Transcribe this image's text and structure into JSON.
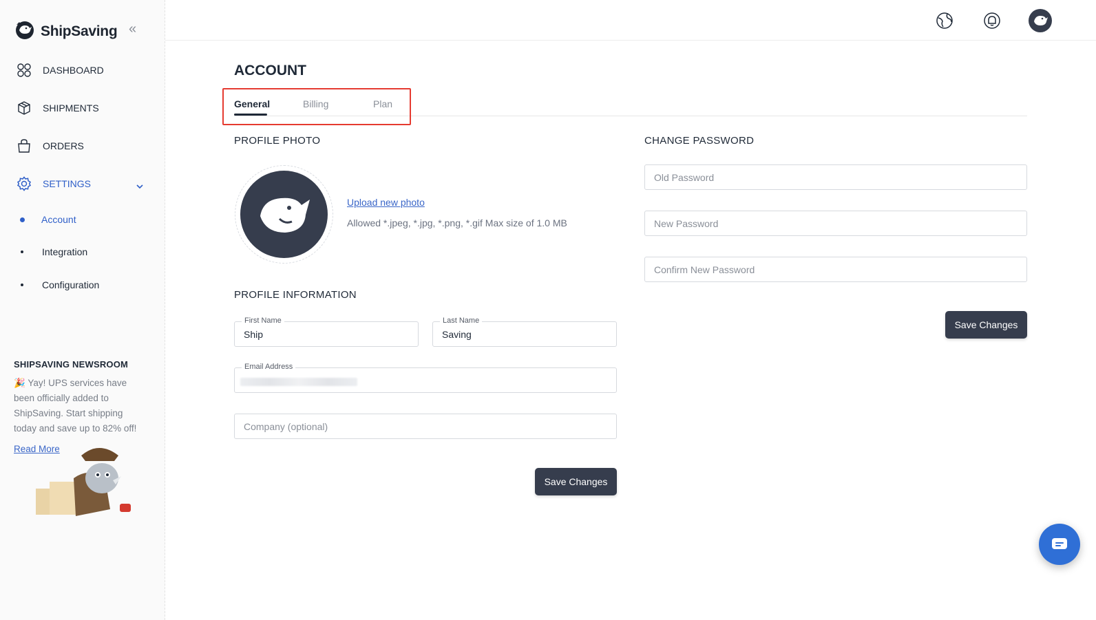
{
  "brand": {
    "name": "ShipSaving"
  },
  "sidebar": {
    "collapse_glyph": "«",
    "items": [
      {
        "label": "DASHBOARD",
        "icon": "dashboard-icon"
      },
      {
        "label": "SHIPMENTS",
        "icon": "package-icon"
      },
      {
        "label": "ORDERS",
        "icon": "shopping-bag-icon"
      },
      {
        "label": "SETTINGS",
        "icon": "gear-icon",
        "active": true
      }
    ],
    "sub_items": [
      {
        "label": "Account",
        "active": true
      },
      {
        "label": "Integration"
      },
      {
        "label": "Configuration"
      }
    ],
    "news": {
      "title": "SHIPSAVING NEWSROOM",
      "emoji": "🎉",
      "body": "Yay! UPS services have been officially added to ShipSaving. Start shipping today and save up to 82% off!",
      "link": "Read More"
    }
  },
  "topbar": {
    "icons": [
      "globe-icon",
      "bell-icon",
      "user-avatar"
    ]
  },
  "main": {
    "title": "ACCOUNT",
    "tabs": [
      {
        "label": "General",
        "active": true
      },
      {
        "label": "Billing"
      },
      {
        "label": "Plan"
      }
    ],
    "profile_photo": {
      "heading": "PROFILE PHOTO",
      "upload_link": "Upload new photo",
      "hint": "Allowed *.jpeg, *.jpg, *.png, *.gif Max size of 1.0 MB"
    },
    "profile_info": {
      "heading": "PROFILE INFORMATION",
      "first_name_label": "First Name",
      "first_name": "Ship",
      "last_name_label": "Last Name",
      "last_name": "Saving",
      "email_label": "Email Address",
      "company_placeholder": "Company (optional)",
      "save_label": "Save Changes"
    },
    "password": {
      "heading": "CHANGE PASSWORD",
      "old_placeholder": "Old Password",
      "new_placeholder": "New Password",
      "confirm_placeholder": "Confirm New Password",
      "save_label": "Save Changes"
    }
  },
  "colors": {
    "accent": "#2f5fc8",
    "button": "#363d4d",
    "highlight": "#e53a30",
    "chat": "#2f6fd6"
  }
}
